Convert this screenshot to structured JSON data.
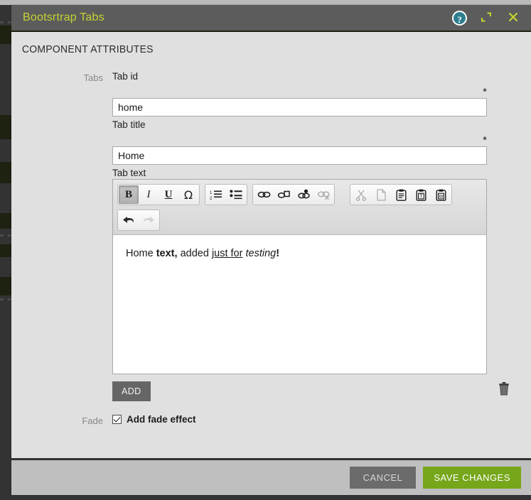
{
  "backdrop": {
    "description": "dark page behind modal"
  },
  "window": {
    "title": "Bootsrtrap Tabs",
    "help_icon": "help-question-icon",
    "maximize_icon": "maximize-icon",
    "close_icon": "close-icon",
    "title_color": "#c5d430",
    "bar_color": "#5c5c5c"
  },
  "section": {
    "heading": "COMPONENT ATTRIBUTES"
  },
  "form": {
    "tabs_group_label": "Tabs",
    "fade_group_label": "Fade",
    "tab_id": {
      "label": "Tab id",
      "required_marker": "*",
      "value": "home",
      "placeholder": ""
    },
    "tab_title": {
      "label": "Tab title",
      "required_marker": "*",
      "value": "Home",
      "placeholder": ""
    },
    "tab_text": {
      "label": "Tab text",
      "content_plain": "Home text, added just for testing!",
      "content_parts": [
        {
          "text": "Home ",
          "style": "normal"
        },
        {
          "text": "text,",
          "style": "bold"
        },
        {
          "text": " added ",
          "style": "normal"
        },
        {
          "text": "just for",
          "style": "underline"
        },
        {
          "text": " ",
          "style": "normal"
        },
        {
          "text": "testing",
          "style": "italic"
        },
        {
          "text": "!",
          "style": "bold"
        }
      ]
    },
    "add_button_label": "ADD",
    "delete_icon": "trash-icon",
    "fade_checkbox": {
      "label": "Add fade effect",
      "checked": true
    }
  },
  "editor_toolbar": {
    "groups": [
      {
        "name": "text-styles",
        "buttons": [
          {
            "name": "bold-button",
            "glyph": "B",
            "state": "active"
          },
          {
            "name": "italic-button",
            "glyph": "I",
            "state": "normal"
          },
          {
            "name": "underline-button",
            "glyph": "U",
            "state": "normal"
          },
          {
            "name": "special-char-button",
            "glyph": "Ω",
            "state": "normal"
          }
        ]
      },
      {
        "name": "lists",
        "buttons": [
          {
            "name": "numbered-list-button",
            "glyph": "numbered-list-icon",
            "state": "normal"
          },
          {
            "name": "bulleted-list-button",
            "glyph": "bulleted-list-icon",
            "state": "normal"
          }
        ]
      },
      {
        "name": "links",
        "buttons": [
          {
            "name": "link-button",
            "glyph": "link-icon",
            "state": "normal"
          },
          {
            "name": "internal-link-button",
            "glyph": "internal-link-icon",
            "state": "normal"
          },
          {
            "name": "anchor-button",
            "glyph": "anchor-link-icon",
            "state": "normal"
          },
          {
            "name": "unlink-button",
            "glyph": "unlink-icon",
            "state": "disabled"
          }
        ]
      },
      {
        "name": "clipboard",
        "buttons": [
          {
            "name": "cut-button",
            "glyph": "scissors-icon",
            "state": "disabled"
          },
          {
            "name": "copy-button",
            "glyph": "copy-icon",
            "state": "disabled"
          },
          {
            "name": "paste-button",
            "glyph": "clipboard-icon",
            "state": "normal"
          },
          {
            "name": "paste-as-text-button",
            "glyph": "clipboard-text-icon",
            "state": "normal"
          },
          {
            "name": "paste-from-word-button",
            "glyph": "clipboard-word-icon",
            "state": "normal"
          }
        ]
      },
      {
        "name": "history",
        "buttons": [
          {
            "name": "undo-button",
            "glyph": "undo-arrow-icon",
            "state": "normal"
          },
          {
            "name": "redo-button",
            "glyph": "redo-arrow-icon",
            "state": "disabled"
          }
        ]
      }
    ]
  },
  "footer": {
    "cancel_label": "CANCEL",
    "save_label": "SAVE CHANGES",
    "cancel_color": "#6b6b6b",
    "save_color": "#76a619"
  }
}
